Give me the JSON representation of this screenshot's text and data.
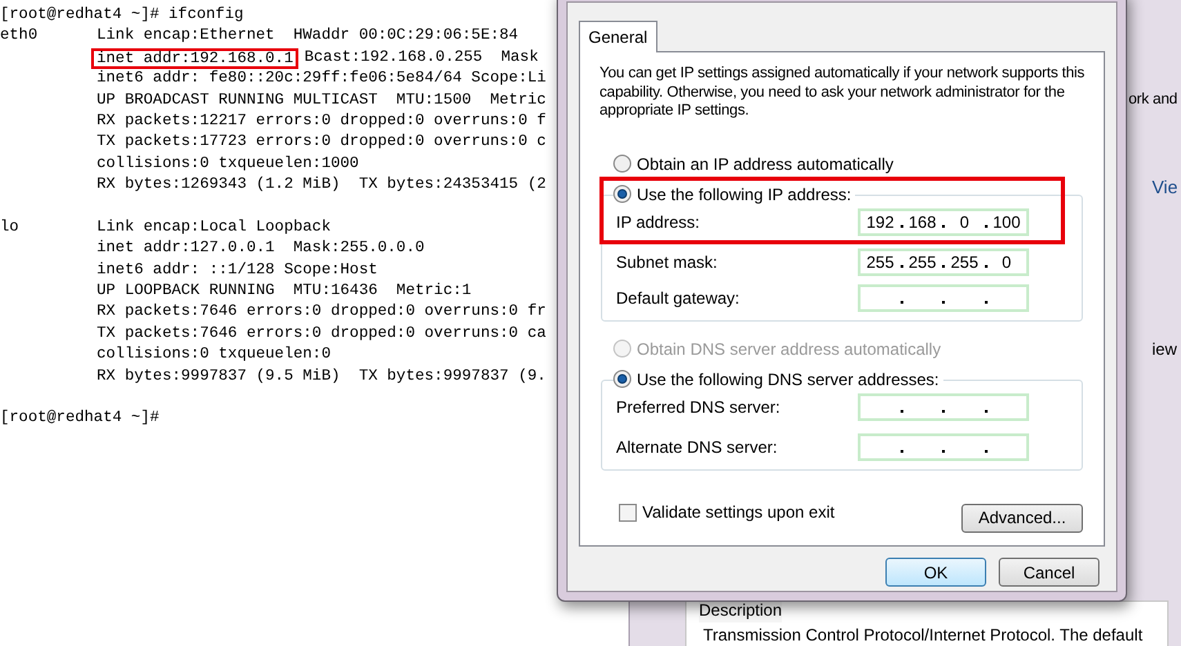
{
  "terminal": {
    "command_prompt": "[root@redhat4 ~]# ifconfig",
    "interfaces": [
      {
        "name": "eth0",
        "lines": [
          {
            "text": "Link encap:Ethernet  HWaddr 00:0C:29:06:5E:84",
            "highlighted": false
          },
          {
            "text": "inet addr:192.168.0.1",
            "rest": "Bcast:192.168.0.255  Mask",
            "highlighted": true
          },
          {
            "text": "inet6 addr: fe80::20c:29ff:fe06:5e84/64 Scope:Li",
            "highlighted": false
          },
          {
            "text": "UP BROADCAST RUNNING MULTICAST  MTU:1500  Metric",
            "highlighted": false
          },
          {
            "text": "RX packets:12217 errors:0 dropped:0 overruns:0 f",
            "highlighted": false
          },
          {
            "text": "TX packets:17723 errors:0 dropped:0 overruns:0 c",
            "highlighted": false
          },
          {
            "text": "collisions:0 txqueuelen:1000",
            "highlighted": false
          },
          {
            "text": "RX bytes:1269343 (1.2 MiB)  TX bytes:24353415 (2",
            "highlighted": false
          }
        ]
      },
      {
        "name": "lo",
        "lines": [
          {
            "text": "Link encap:Local Loopback",
            "highlighted": false
          },
          {
            "text": "inet addr:127.0.0.1  Mask:255.0.0.0",
            "highlighted": false
          },
          {
            "text": "inet6 addr: ::1/128 Scope:Host",
            "highlighted": false
          },
          {
            "text": "UP LOOPBACK RUNNING  MTU:16436  Metric:1",
            "highlighted": false
          },
          {
            "text": "RX packets:7646 errors:0 dropped:0 overruns:0 fr",
            "highlighted": false
          },
          {
            "text": "TX packets:7646 errors:0 dropped:0 overruns:0 ca",
            "highlighted": false
          },
          {
            "text": "collisions:0 txqueuelen:0",
            "highlighted": false
          },
          {
            "text": "RX bytes:9997837 (9.5 MiB)  TX bytes:9997837 (9.",
            "highlighted": false
          }
        ]
      }
    ],
    "final_prompt": "[root@redhat4 ~]#"
  },
  "background_window": {
    "fragments": [
      "ork and",
      "Vie",
      "iew"
    ],
    "description_title": "Description",
    "description_text": "Transmission Control Protocol/Internet Protocol. The default"
  },
  "dialog": {
    "tabs": [
      {
        "label": "General",
        "selected": true
      }
    ],
    "intro": "You can get IP settings assigned automatically if your network supports this capability. Otherwise, you need to ask your network administrator for the appropriate IP settings.",
    "ip_auto": {
      "label": "Obtain an IP address automatically",
      "selected": false,
      "disabled": false
    },
    "ip_section": {
      "label": "Use the following IP address:",
      "selected": true,
      "highlighted": true,
      "fields": [
        {
          "label": "IP address:",
          "octets": [
            "192",
            "168",
            "0",
            "100"
          ]
        },
        {
          "label": "Subnet mask:",
          "octets": [
            "255",
            "255",
            "255",
            "0"
          ]
        },
        {
          "label": "Default gateway:"
        }
      ]
    },
    "dns_auto": {
      "label": "Obtain DNS server address automatically",
      "selected": false,
      "disabled": true
    },
    "dns_section": {
      "label": "Use the following DNS server addresses:",
      "selected": true,
      "highlighted": false,
      "fields": [
        {
          "label": "Preferred DNS server:"
        },
        {
          "label": "Alternate DNS server:"
        }
      ]
    },
    "validate": {
      "label": "Validate settings upon exit",
      "checked": false
    },
    "advanced_button": "Advanced...",
    "buttons": [
      {
        "label": "OK",
        "default": true
      },
      {
        "label": "Cancel",
        "default": false
      }
    ]
  }
}
